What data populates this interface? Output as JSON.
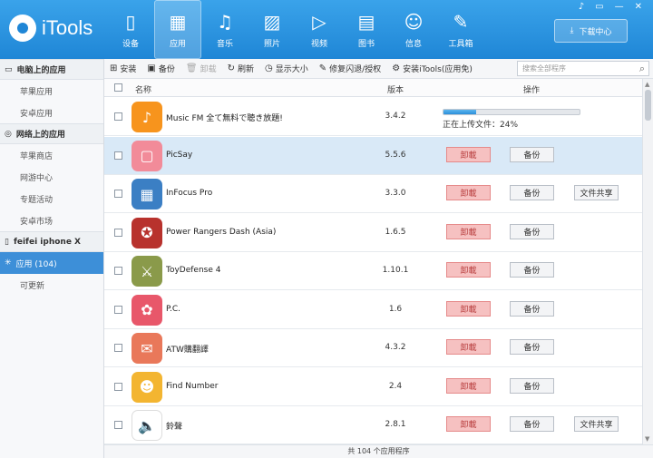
{
  "app": {
    "logo_text": "iTools"
  },
  "nav": [
    {
      "label": "设备",
      "icon": "phone-icon",
      "glyph": "▯"
    },
    {
      "label": "应用",
      "icon": "apps-icon",
      "glyph": "▦"
    },
    {
      "label": "音乐",
      "icon": "music-icon",
      "glyph": "♫"
    },
    {
      "label": "照片",
      "icon": "photo-icon",
      "glyph": "▨"
    },
    {
      "label": "视频",
      "icon": "video-icon",
      "glyph": "▷"
    },
    {
      "label": "图书",
      "icon": "book-icon",
      "glyph": "▤"
    },
    {
      "label": "信息",
      "icon": "user-icon",
      "glyph": "☺"
    },
    {
      "label": "工具箱",
      "icon": "wrench-icon",
      "glyph": "✎"
    }
  ],
  "download_center": "下载中心",
  "sidebar": {
    "pc_header": "电脑上的应用",
    "pc_items": [
      "苹果应用",
      "安卓应用"
    ],
    "net_header": "网络上的应用",
    "net_items": [
      "苹果商店",
      "网游中心",
      "专题活动",
      "安卓市场"
    ],
    "device_header": "feifei iphone X",
    "device_active": "应用 (104)",
    "device_items": [
      "可更新"
    ]
  },
  "toolbar": {
    "install": "安装",
    "backup": "备份",
    "uninstall": "卸载",
    "refresh": "刷新",
    "icon_size": "显示大小",
    "repair": "修复闪退/授权",
    "install_itools": "安装iTools(应用免)",
    "search_placeholder": "搜索全部程序"
  },
  "table": {
    "col_name": "名称",
    "col_version": "版本",
    "col_action": "操作",
    "btn_uninstall": "卸載",
    "btn_backup": "备份",
    "btn_share": "文件共享",
    "rows": [
      {
        "name": "Music FM 全て無料で聴き放題!",
        "version": "3.4.2",
        "uploading": true,
        "progress_text": "正在上传文件：24%",
        "progress": 0.24,
        "color": "#f7941d",
        "glyph": "♪"
      },
      {
        "name": "PicSay",
        "version": "5.5.6",
        "selected": true,
        "color": "#f28b99",
        "glyph": "▢"
      },
      {
        "name": "InFocus Pro",
        "version": "3.3.0",
        "share": true,
        "color": "#3b7fc4",
        "glyph": "▦"
      },
      {
        "name": "Power Rangers Dash (Asia)",
        "version": "1.6.5",
        "color": "#b8322d",
        "glyph": "✪"
      },
      {
        "name": "ToyDefense 4",
        "version": "1.10.1",
        "color": "#8a9a4a",
        "glyph": "⚔"
      },
      {
        "name": "P.C.",
        "version": "1.6",
        "color": "#e8576a",
        "glyph": "✿"
      },
      {
        "name": "ATW購翻譯",
        "version": "4.3.2",
        "color": "#e9785a",
        "glyph": "✉"
      },
      {
        "name": "Find Number",
        "version": "2.4",
        "color": "#f3b531",
        "glyph": "☻"
      },
      {
        "name": "鈴聲",
        "version": "2.8.1",
        "share": true,
        "color": "#ffffff",
        "glyph": "🔈"
      }
    ]
  },
  "status_text": "共 104 个应用程序"
}
